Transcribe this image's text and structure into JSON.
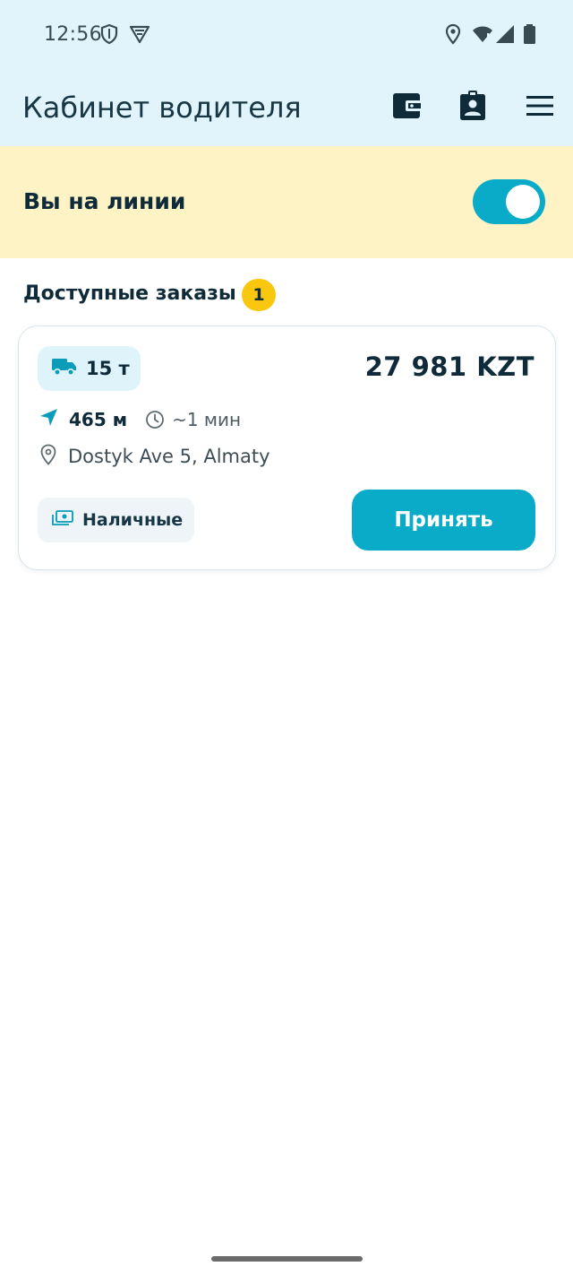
{
  "status_bar": {
    "time": "12:56",
    "icons": [
      "shield-icon",
      "vpn-icon",
      "location-icon",
      "wifi-icon",
      "signal-icon",
      "battery-icon"
    ]
  },
  "header": {
    "title": "Кабинет водителя",
    "actions": [
      "wallet-icon",
      "id-card-icon",
      "menu-icon"
    ]
  },
  "online": {
    "label": "Вы на линии",
    "enabled": true
  },
  "orders_section": {
    "title": "Доступные заказы",
    "count": "1"
  },
  "order": {
    "weight": "15 т",
    "price": "27 981 KZT",
    "distance": "465 м",
    "eta": "~1 мин",
    "address": "Dostyk Ave 5, Almaty",
    "payment": "Наличные",
    "accept_label": "Принять"
  },
  "colors": {
    "header_bg": "#e1f4fb",
    "banner_bg": "#fdf3c4",
    "accent": "#0aabc8",
    "badge": "#f9c80e",
    "text_dark": "#0f2b3a"
  }
}
